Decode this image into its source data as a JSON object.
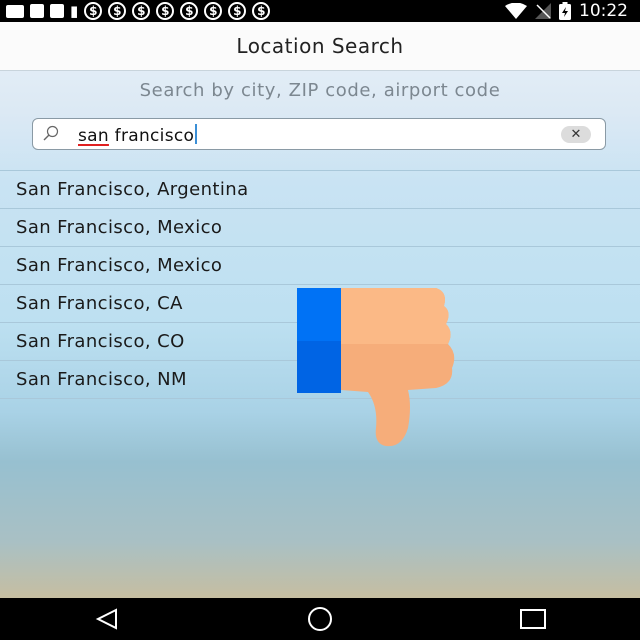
{
  "status_bar": {
    "time": "10:22",
    "icons": [
      "message-icon",
      "flipboard-icon",
      "flipboard-icon",
      "notification-icon",
      "dollar-icon",
      "dollar-icon",
      "dollar-icon",
      "dollar-icon",
      "dollar-icon",
      "dollar-icon",
      "dollar-icon",
      "dollar-icon"
    ],
    "right_icons": [
      "wifi-icon",
      "signal-off-icon",
      "battery-charging-icon"
    ]
  },
  "header": {
    "title": "Location Search"
  },
  "search": {
    "hint": "Search by city, ZIP code, airport code",
    "value": "san francisco",
    "value_misspelled": "san",
    "value_rest": " francisco",
    "clear_symbol": "✕"
  },
  "results": [
    {
      "label": "San Francisco, Argentina"
    },
    {
      "label": "San Francisco, Mexico"
    },
    {
      "label": "San Francisco, Mexico"
    },
    {
      "label": "San Francisco, CA"
    },
    {
      "label": "San Francisco, CO"
    },
    {
      "label": "San Francisco, NM"
    }
  ],
  "nav_bar": {
    "icons": [
      "back-icon",
      "home-icon",
      "recents-icon"
    ]
  },
  "colors": {
    "accent": "#3b8fd6",
    "ad_blue": "#0066ee",
    "ad_hand": "#f6ad7a"
  }
}
